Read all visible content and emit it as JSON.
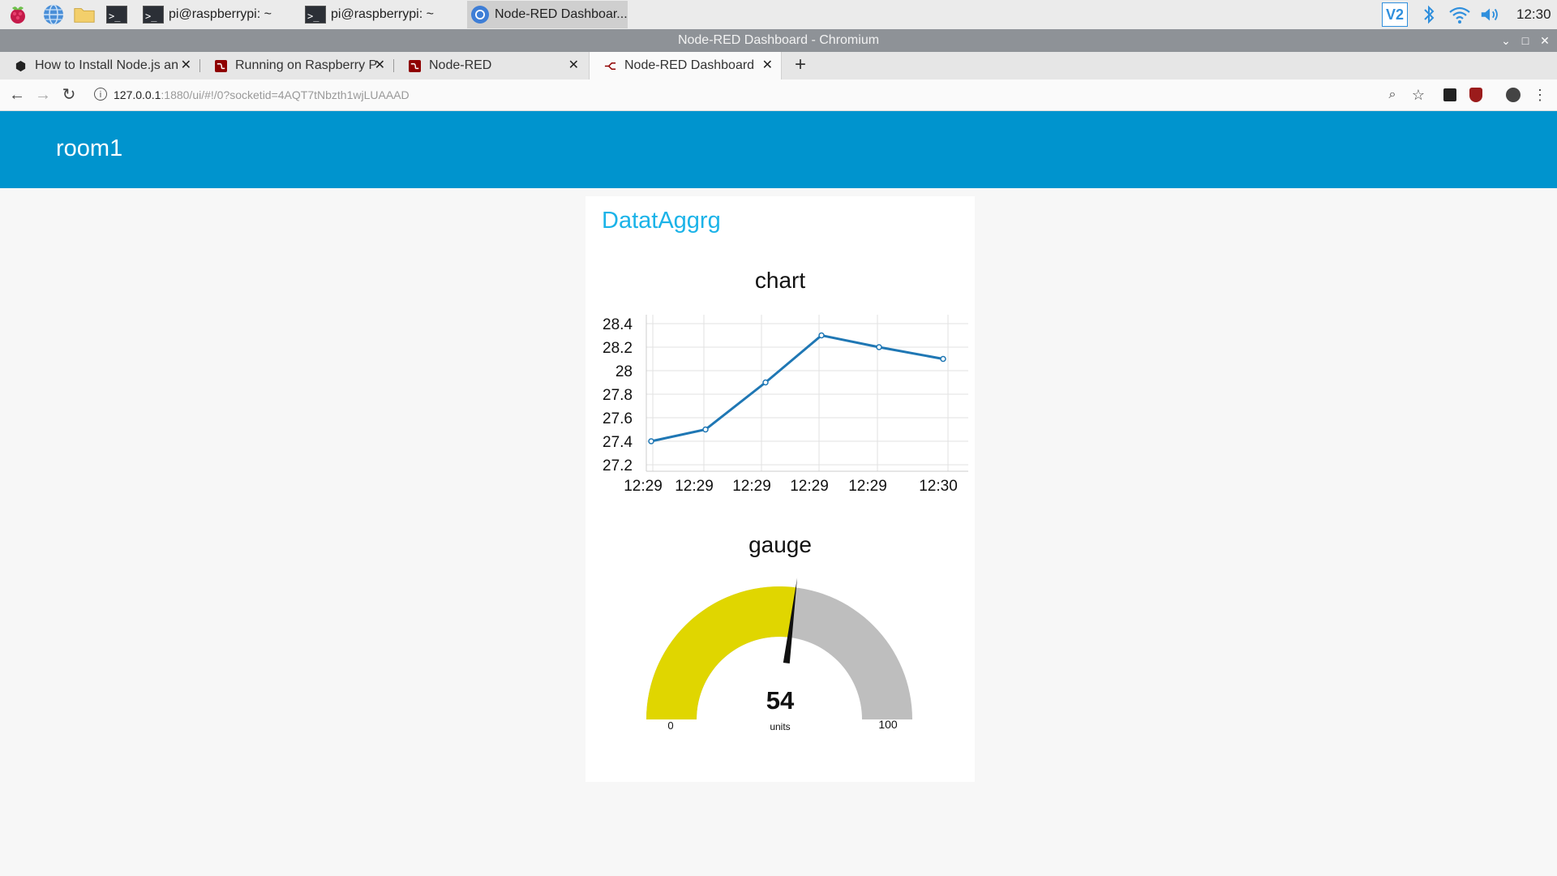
{
  "taskbar": {
    "tasks": [
      {
        "label": "pi@raspberrypi: ~"
      },
      {
        "label": "pi@raspberrypi: ~"
      },
      {
        "label": "Node-RED Dashboar..."
      }
    ],
    "clock": "12:30",
    "vnc_label": "V2",
    "icons": [
      "raspberry-icon",
      "globe-icon",
      "folder-icon",
      "terminal-icon",
      "vnc-icon",
      "bluetooth-icon",
      "wifi-icon",
      "volume-icon"
    ]
  },
  "window": {
    "title": "Node-RED Dashboard - Chromium"
  },
  "browser": {
    "tabs": [
      {
        "label": "How to Install Node.js an"
      },
      {
        "label": "Running on Raspberry P"
      },
      {
        "label": "Node-RED"
      },
      {
        "label": "Node-RED Dashboard"
      }
    ],
    "new_tab": "+",
    "url_host": "127.0.0.1",
    "url_rest": ":1880/ui/#!/0?socketid=4AQT7tNbzth1wjLUAAAD"
  },
  "page": {
    "tab_title": "room1",
    "group_title": "DatatAggrg"
  },
  "chart_data": [
    {
      "type": "line",
      "title": "chart",
      "x": [
        "12:29",
        "12:29",
        "12:29",
        "12:29",
        "12:29",
        "12:30"
      ],
      "series": [
        {
          "values": [
            27.4,
            27.5,
            27.9,
            28.3,
            28.2,
            28.1
          ]
        }
      ],
      "yticks": [
        "28.4",
        "28.2",
        "28",
        "27.8",
        "27.6",
        "27.4",
        "27.2"
      ],
      "ylim": [
        27.2,
        28.4
      ],
      "grid": true,
      "color": "#1f77b4"
    },
    {
      "type": "gauge",
      "title": "gauge",
      "value": 54,
      "min": 0,
      "max": 100,
      "min_label": "0",
      "max_label": "100",
      "units": "units",
      "fill_color": "#e0d600",
      "track_color": "#bebebe"
    }
  ]
}
